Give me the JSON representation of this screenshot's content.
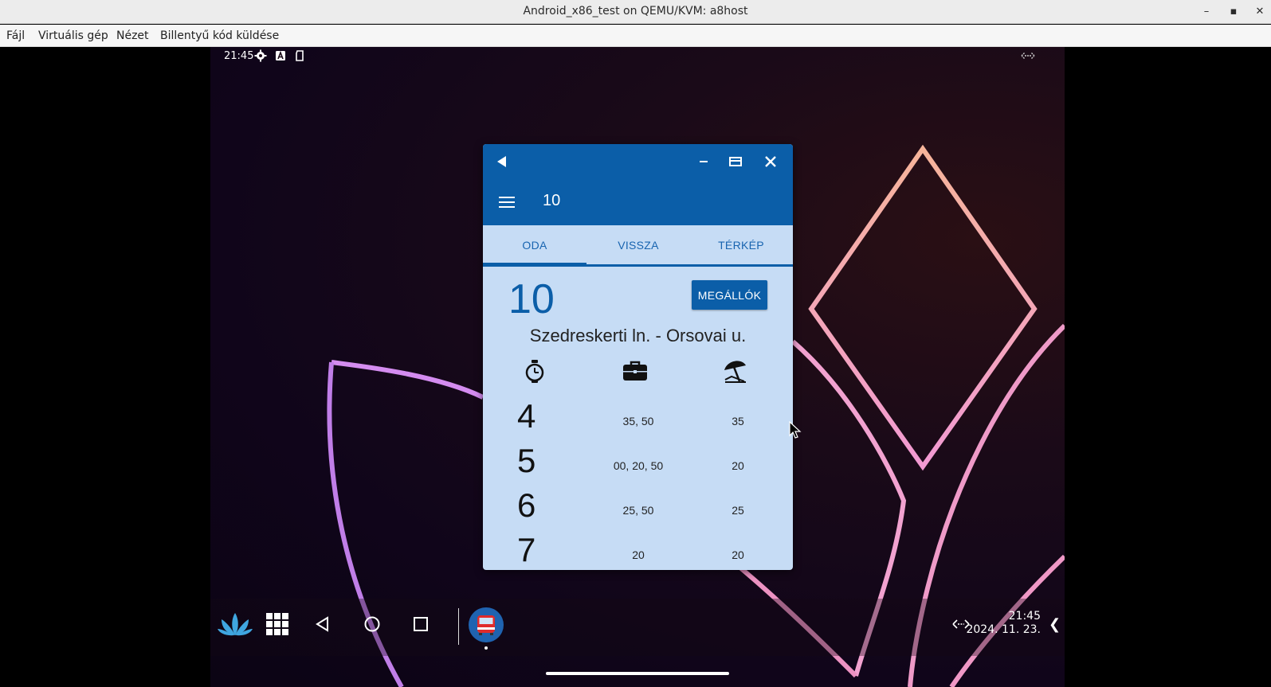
{
  "host": {
    "title": "Android_x86_test on QEMU/KVM: a8host",
    "menu": [
      "Fájl",
      "Virtuális gép",
      "Nézet",
      "Billentyű kód küldése"
    ],
    "controls": {
      "minimize": "–",
      "maximize": "▪",
      "close": "✕"
    }
  },
  "status_bar": {
    "time": "21:45",
    "icons": [
      "gear-icon",
      "keyboard-a-icon",
      "sd-card-icon"
    ],
    "right_icon": "resize-horizontal-icon"
  },
  "app": {
    "caption_icons": [
      "back-triangle-icon",
      "minimize-icon",
      "restore-icon",
      "close-icon"
    ],
    "toolbar_title": "10",
    "tabs": [
      "ODA",
      "VISSZA",
      "TÉRKÉP"
    ],
    "selected_tab": "ODA",
    "route_number": "10",
    "stops_button": "MEGÁLLÓK",
    "route_name": "Szedreskerti ln. - Orsovai u.",
    "columns": [
      "stopwatch-icon",
      "briefcase-icon",
      "beach-umbrella-icon"
    ],
    "schedule": [
      {
        "hour": "4",
        "workday": "35, 50",
        "holiday": "35"
      },
      {
        "hour": "5",
        "workday": "00, 20, 50",
        "holiday": "20"
      },
      {
        "hour": "6",
        "workday": "25, 50",
        "holiday": "25"
      },
      {
        "hour": "7",
        "workday": "20",
        "holiday": "20"
      }
    ],
    "colors": {
      "primary": "#0b5ea8",
      "background": "#c6dcf5"
    }
  },
  "taskbar": {
    "icons": [
      "lotus-launcher-icon",
      "app-grid-icon",
      "back-icon",
      "home-icon",
      "recents-icon",
      "bus-app-icon"
    ],
    "tray_icon": "resize-horizontal-icon",
    "clock_time": "21:45",
    "clock_date": "2024. 11. 23.",
    "chevron": "❮"
  }
}
